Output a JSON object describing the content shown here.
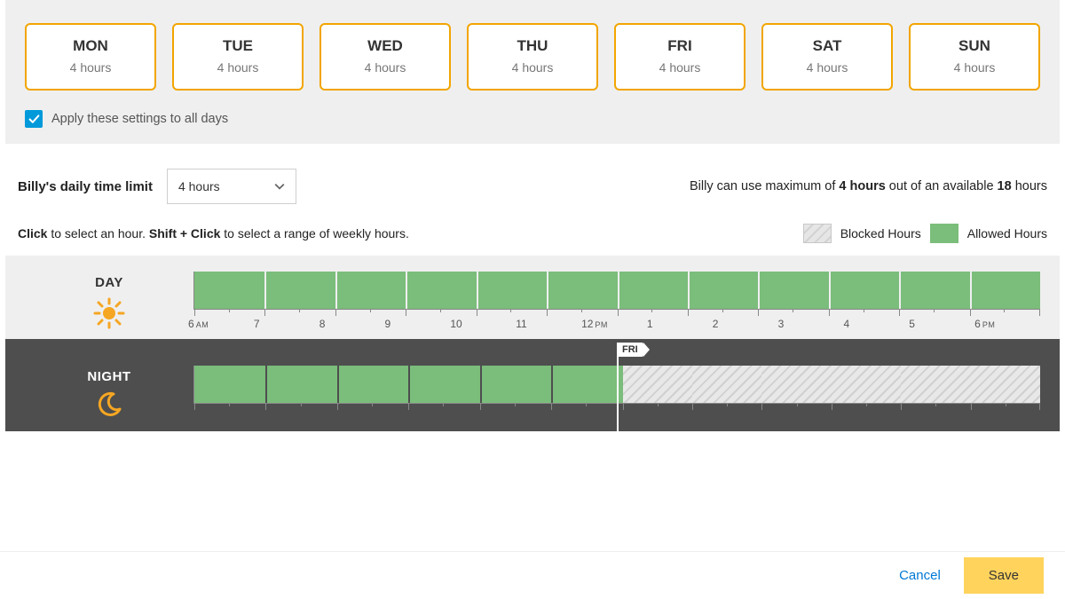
{
  "days": [
    {
      "abbr": "MON",
      "hours": "4 hours"
    },
    {
      "abbr": "TUE",
      "hours": "4 hours"
    },
    {
      "abbr": "WED",
      "hours": "4 hours"
    },
    {
      "abbr": "THU",
      "hours": "4 hours"
    },
    {
      "abbr": "FRI",
      "hours": "4 hours"
    },
    {
      "abbr": "SAT",
      "hours": "4 hours"
    },
    {
      "abbr": "SUN",
      "hours": "4 hours"
    }
  ],
  "apply_all_label": "Apply these settings to all days",
  "limit": {
    "label_prefix": "Billy's",
    "label_rest": " daily time limit",
    "dropdown_value": "4 hours",
    "summary_prefix": "Billy can use maximum of ",
    "summary_bold1": "4 hours",
    "summary_mid": " out of an available ",
    "summary_bold2": "18",
    "summary_suffix": " hours"
  },
  "tip": {
    "click": "Click",
    "click_rest": " to select an hour. ",
    "shift": "Shift + Click",
    "shift_rest": " to select a range of weekly hours."
  },
  "legend": {
    "blocked": "Blocked Hours",
    "allowed": "Allowed Hours"
  },
  "schedule": {
    "day_label": "DAY",
    "night_label": "NIGHT",
    "day_ticks": [
      "6 AM",
      "7",
      "8",
      "9",
      "10",
      "11",
      "12 PM",
      "1",
      "2",
      "3",
      "4",
      "5",
      "6 PM"
    ],
    "day_slots": [
      "allowed",
      "allowed",
      "allowed",
      "allowed",
      "allowed",
      "allowed",
      "allowed",
      "allowed",
      "allowed",
      "allowed",
      "allowed",
      "allowed"
    ],
    "night_slots": [
      "allowed",
      "allowed",
      "allowed",
      "allowed",
      "allowed",
      "allowed",
      "blocked",
      "blocked",
      "blocked",
      "blocked",
      "blocked",
      "blocked"
    ],
    "fri_tag": "FRI"
  },
  "footer": {
    "cancel": "Cancel",
    "save": "Save"
  }
}
